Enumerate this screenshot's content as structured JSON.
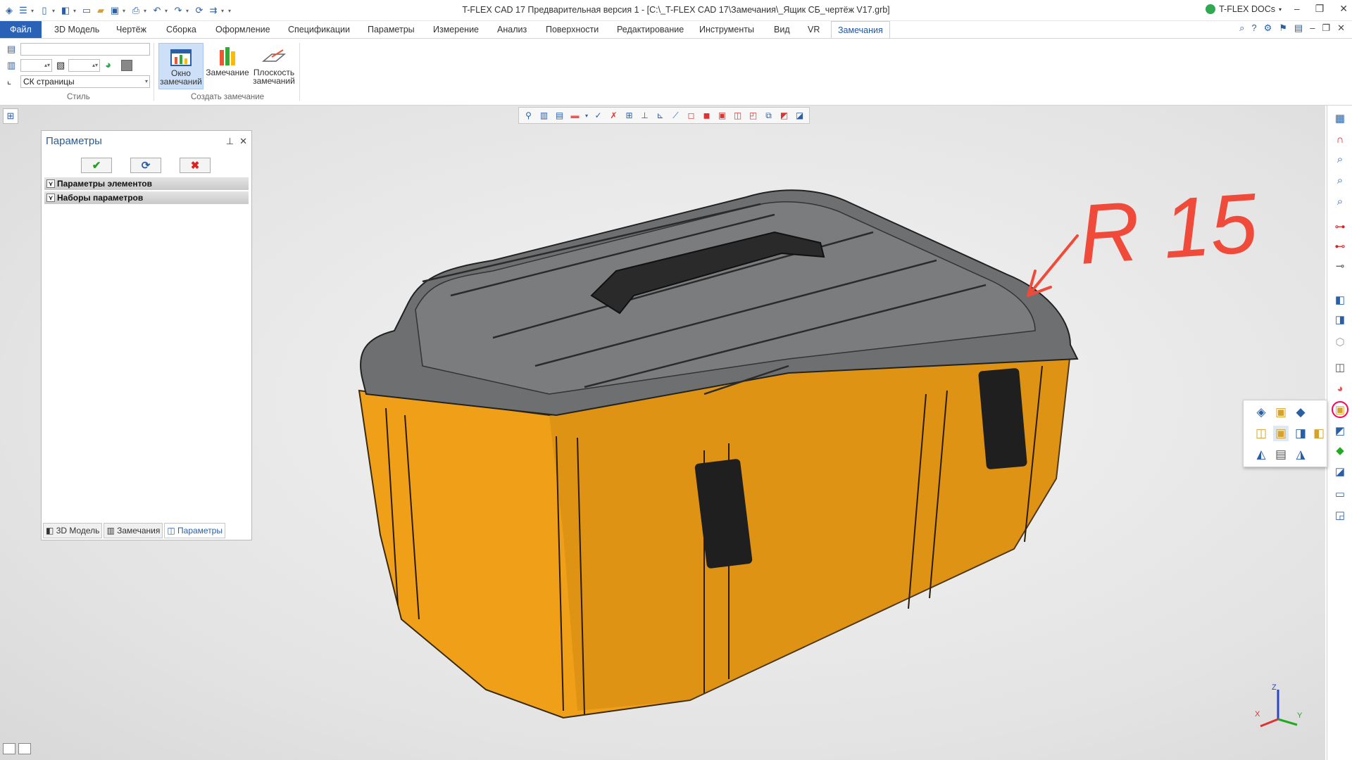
{
  "window": {
    "title": "T-FLEX CAD 17 Предварительная версия 1 - [C:\\_T-FLEX CAD 17\\Замечания\\_Ящик СБ_чертёж V17.grb]",
    "docs_label": "T-FLEX DOCs"
  },
  "menu": {
    "file": "Файл",
    "tabs": [
      "3D Модель",
      "Чертёж",
      "Сборка",
      "Оформление",
      "Спецификации",
      "Параметры",
      "Измерение",
      "Анализ",
      "Поверхности",
      "Редактирование",
      "Инструменты",
      "Вид",
      "VR"
    ],
    "active_tab": "Замечания"
  },
  "ribbon": {
    "style_group": {
      "label": "Стиль",
      "layer_value": "",
      "cs_value": "СК страницы"
    },
    "create_group": {
      "label": "Создать замечание",
      "buttons": [
        {
          "label1": "Окно",
          "label2": "замечаний",
          "selected": true
        },
        {
          "label1": "Замечание",
          "label2": "",
          "selected": false
        },
        {
          "label1": "Плоскость",
          "label2": "замечаний",
          "selected": false
        }
      ]
    }
  },
  "params_panel": {
    "title": "Параметры",
    "sections": [
      "Параметры элементов",
      "Наборы параметров"
    ],
    "tabs": [
      "3D Модель",
      "Замечания",
      "Параметры"
    ],
    "active_tab": "Параметры"
  },
  "annotation": {
    "text": "R 15",
    "color": "#f04a3a"
  },
  "axes": {
    "x": "X",
    "y": "Y",
    "z": "Z"
  },
  "colors": {
    "accent": "#2a62b8",
    "body": "#f0a018",
    "lid": "#6e6f70",
    "latch": "#1f1f1f"
  }
}
